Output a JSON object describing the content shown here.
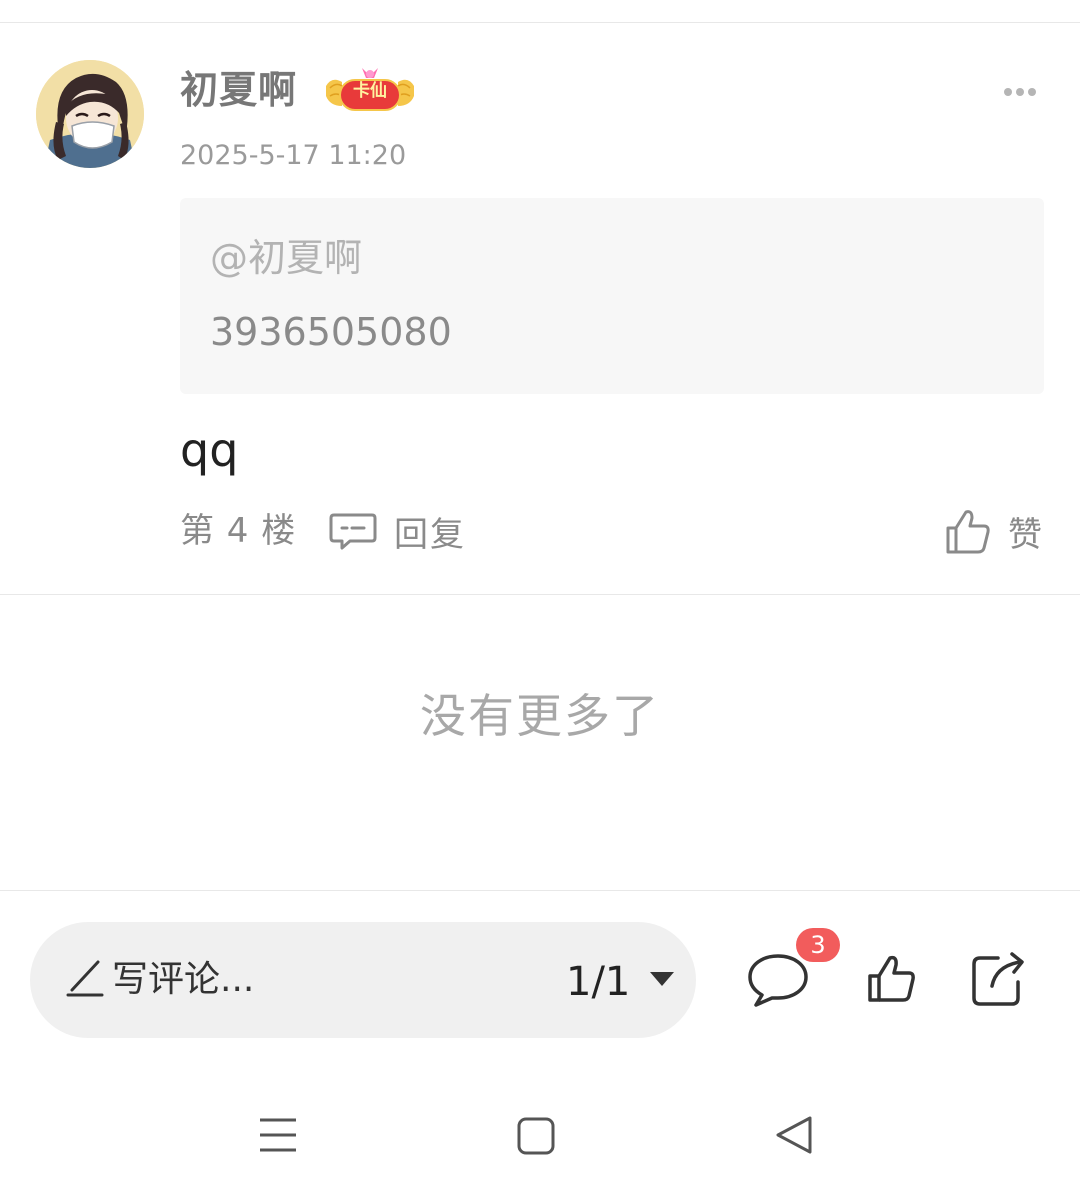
{
  "post": {
    "username": "初夏啊",
    "badge_label": "卡仙",
    "timestamp": "2025-5-17 11:20",
    "quote": {
      "author": "@初夏啊",
      "text": "3936505080"
    },
    "content": "qq",
    "floor": "第 4 楼",
    "reply_label": "回复",
    "like_label": "赞"
  },
  "list_end_text": "没有更多了",
  "bottom_bar": {
    "comment_placeholder": "写评论...",
    "page_indicator": "1/1",
    "comment_count": "3"
  },
  "colors": {
    "badge_red": "#e83a3a",
    "count_badge": "#f25c5c",
    "quote_background": "#f7f7f7",
    "comment_bar_background": "#f0f0f0"
  },
  "icons": {
    "more": "more-dots-icon",
    "reply": "comment-bubble-icon",
    "like": "thumbs-up-icon",
    "comments": "speech-bubble-icon",
    "share": "share-icon",
    "edit": "pencil-icon",
    "dropdown": "triangle-down-icon",
    "nav_menu": "hamburger-icon",
    "nav_home": "square-icon",
    "nav_back": "triangle-back-icon"
  }
}
